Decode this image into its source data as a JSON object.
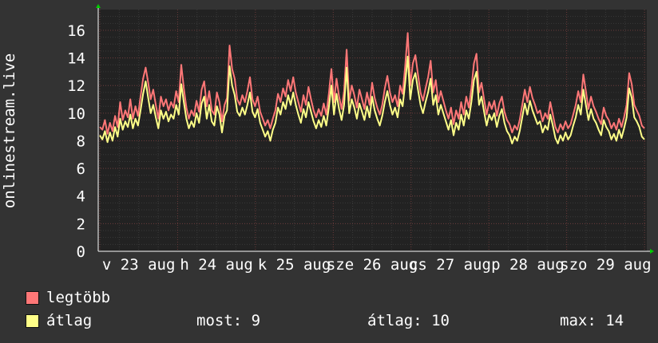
{
  "chart_data": {
    "type": "line",
    "ylabel": "onlinestream.live",
    "ylim": [
      0,
      17.5
    ],
    "yticks": [
      0,
      2,
      4,
      6,
      8,
      10,
      12,
      14,
      16
    ],
    "grid": true,
    "xtick_labels": [
      "v 23 aug",
      "h 24 aug",
      "k 25 aug",
      "sze 26 aug",
      "cs 27 aug",
      "p 28 aug",
      "szo 29 aug"
    ],
    "series": [
      {
        "name": "legtöbb",
        "color": "#ff7777",
        "values": [
          9.0,
          8.8,
          9.5,
          8.5,
          9.3,
          8.7,
          9.8,
          9.0,
          10.8,
          9.5,
          10.2,
          9.7,
          11.0,
          9.6,
          10.5,
          9.8,
          11.2,
          12.5,
          13.3,
          12.2,
          11.0,
          11.7,
          10.6,
          9.6,
          11.2,
          10.5,
          11.0,
          10.2,
          10.8,
          10.4,
          11.6,
          10.8,
          13.5,
          11.8,
          10.4,
          9.6,
          10.2,
          9.8,
          10.9,
          10.1,
          11.7,
          12.3,
          10.5,
          11.6,
          10.2,
          9.9,
          11.5,
          10.8,
          9.4,
          10.6,
          11.1,
          14.9,
          13.2,
          12.5,
          11.0,
          10.6,
          11.3,
          10.8,
          11.6,
          12.6,
          11.0,
          10.5,
          11.2,
          10.1,
          9.6,
          9.1,
          9.5,
          8.9,
          9.6,
          10.2,
          11.4,
          10.8,
          11.8,
          11.2,
          12.4,
          11.6,
          12.6,
          11.5,
          10.8,
          10.1,
          11.3,
          10.6,
          11.9,
          11.0,
          10.2,
          9.7,
          10.3,
          9.8,
          10.7,
          9.9,
          11.4,
          13.2,
          10.8,
          12.5,
          11.2,
          10.3,
          11.6,
          14.6,
          10.9,
          12.0,
          11.3,
          10.4,
          11.7,
          11.0,
          10.3,
          11.5,
          10.6,
          12.2,
          11.1,
          10.4,
          9.9,
          10.6,
          11.8,
          12.7,
          11.5,
          10.8,
          11.3,
          10.5,
          12.0,
          11.4,
          13.4,
          15.8,
          12.0,
          13.6,
          14.2,
          12.8,
          11.5,
          10.9,
          11.8,
          12.6,
          13.8,
          11.5,
          12.4,
          10.8,
          11.6,
          10.9,
          10.2,
          9.6,
          10.4,
          9.2,
          10.2,
          9.6,
          10.8,
          9.9,
          11.2,
          10.4,
          11.8,
          13.6,
          14.3,
          11.5,
          12.2,
          11.0,
          9.9,
          10.8,
          10.3,
          10.9,
          9.8,
          10.7,
          11.2,
          10.1,
          9.5,
          9.2,
          8.6,
          9.1,
          8.8,
          9.5,
          10.6,
          11.7,
          10.8,
          11.9,
          11.1,
          10.6,
          10.0,
          10.2,
          9.4,
          10.0,
          9.6,
          10.8,
          9.9,
          9.0,
          8.6,
          9.2,
          8.8,
          9.4,
          8.9,
          9.2,
          9.9,
          10.6,
          11.6,
          10.8,
          12.8,
          11.6,
          10.3,
          11.2,
          10.5,
          10.1,
          9.6,
          9.2,
          10.4,
          9.8,
          9.5,
          8.9,
          9.3,
          8.8,
          9.6,
          9.0,
          9.7,
          10.6,
          12.9,
          12.1,
          10.6,
          10.2,
          9.8,
          9.1,
          8.9
        ],
        "description": "maximum"
      },
      {
        "name": "átlag",
        "color": "#ffff88",
        "values": [
          8.4,
          8.1,
          8.7,
          7.9,
          8.6,
          8.0,
          9.0,
          8.3,
          9.6,
          8.8,
          9.4,
          9.0,
          9.9,
          8.9,
          9.6,
          9.1,
          10.2,
          11.4,
          12.3,
          11.1,
          10.0,
          10.6,
          9.7,
          8.9,
          10.2,
          9.6,
          10.1,
          9.4,
          9.9,
          9.6,
          10.6,
          9.9,
          12.1,
          10.8,
          9.6,
          8.9,
          9.4,
          9.0,
          10.0,
          9.3,
          10.7,
          11.2,
          9.6,
          10.6,
          9.4,
          9.1,
          10.5,
          9.9,
          8.6,
          9.8,
          10.2,
          13.4,
          12.0,
          11.3,
          10.1,
          9.8,
          10.4,
          9.9,
          10.6,
          11.5,
          10.1,
          9.7,
          10.3,
          9.3,
          8.8,
          8.3,
          8.7,
          8.0,
          8.8,
          9.3,
          10.4,
          9.9,
          10.8,
          10.3,
          11.3,
          10.6,
          11.5,
          10.6,
          9.9,
          9.3,
          10.3,
          9.7,
          10.8,
          10.1,
          9.4,
          8.9,
          9.5,
          9.0,
          9.8,
          9.1,
          10.4,
          12.0,
          9.9,
          11.4,
          10.3,
          9.5,
          10.6,
          13.3,
          10.0,
          11.0,
          10.4,
          9.6,
          10.7,
          10.1,
          9.5,
          10.5,
          9.7,
          11.2,
          10.2,
          9.6,
          9.1,
          9.8,
          10.8,
          11.6,
          10.6,
          9.9,
          10.4,
          9.7,
          11.0,
          10.5,
          12.2,
          14.1,
          11.0,
          12.4,
          12.9,
          11.7,
          10.6,
          10.0,
          10.8,
          11.5,
          12.5,
          10.6,
          11.3,
          9.9,
          10.6,
          10.0,
          9.4,
          8.8,
          9.5,
          8.4,
          9.3,
          8.8,
          9.9,
          9.1,
          10.2,
          9.6,
          10.8,
          12.4,
          13.0,
          10.6,
          11.2,
          10.1,
          9.1,
          9.9,
          9.5,
          10.0,
          9.0,
          9.8,
          10.3,
          9.3,
          8.7,
          8.4,
          7.8,
          8.3,
          8.0,
          8.7,
          9.7,
          10.7,
          9.9,
          10.9,
          10.2,
          9.7,
          9.2,
          9.4,
          8.6,
          9.1,
          8.8,
          9.9,
          9.1,
          8.2,
          7.8,
          8.4,
          8.0,
          8.6,
          8.1,
          8.4,
          9.1,
          9.7,
          10.6,
          9.9,
          11.7,
          10.6,
          9.5,
          10.3,
          9.6,
          9.3,
          8.8,
          8.4,
          9.5,
          9.0,
          8.7,
          8.1,
          8.5,
          8.0,
          8.8,
          8.2,
          8.9,
          9.7,
          11.8,
          11.1,
          9.7,
          9.4,
          9.0,
          8.3,
          8.1
        ]
      }
    ]
  },
  "legend": [
    {
      "label": "legtöbb",
      "color": "#ff7777"
    },
    {
      "label": "átlag",
      "color": "#ffff88"
    }
  ],
  "stats": {
    "most": "most: 9",
    "atlag": "átlag: 10",
    "max": "max: 14"
  }
}
